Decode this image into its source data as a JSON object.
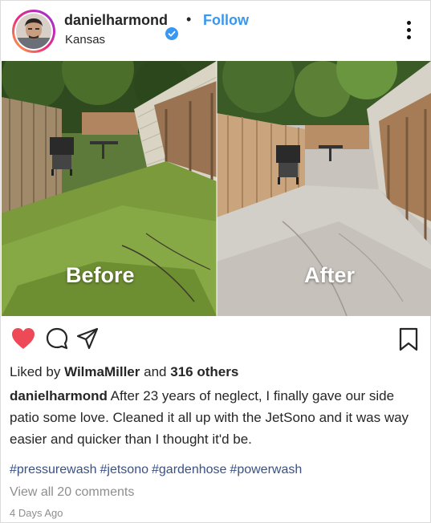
{
  "post": {
    "username": "danielharmond",
    "location": "Kansas",
    "follow_label": "Follow",
    "separator": "•",
    "image": {
      "before_label": "Before",
      "after_label": "After"
    },
    "liked_by_prefix": "Liked by",
    "liked_by_user": "WilmaMiller",
    "liked_by_and": "and",
    "liked_by_others": "316 others",
    "caption_user": "danielharmond",
    "caption_text": "After 23 years of neglect, I finally gave our side patio some love. Cleaned it all up with the JetSono and it was way easier and quicker than I thought it'd be.",
    "hashtags": [
      "#pressurewash",
      "#jetsono",
      "#gardenhose",
      "#powerwash"
    ],
    "view_comments": "View all 20 comments",
    "timestamp": "4 Days Ago"
  },
  "icons": {
    "like": "heart-icon",
    "comment": "comment-icon",
    "share": "paper-plane-icon",
    "save": "bookmark-icon",
    "more": "more-dots-icon",
    "verified": "verified-badge-icon"
  },
  "colors": {
    "like_red": "#ed4956",
    "follow_blue": "#3897f0",
    "hashtag_blue": "#385185",
    "muted_gray": "#8e8e8e"
  }
}
